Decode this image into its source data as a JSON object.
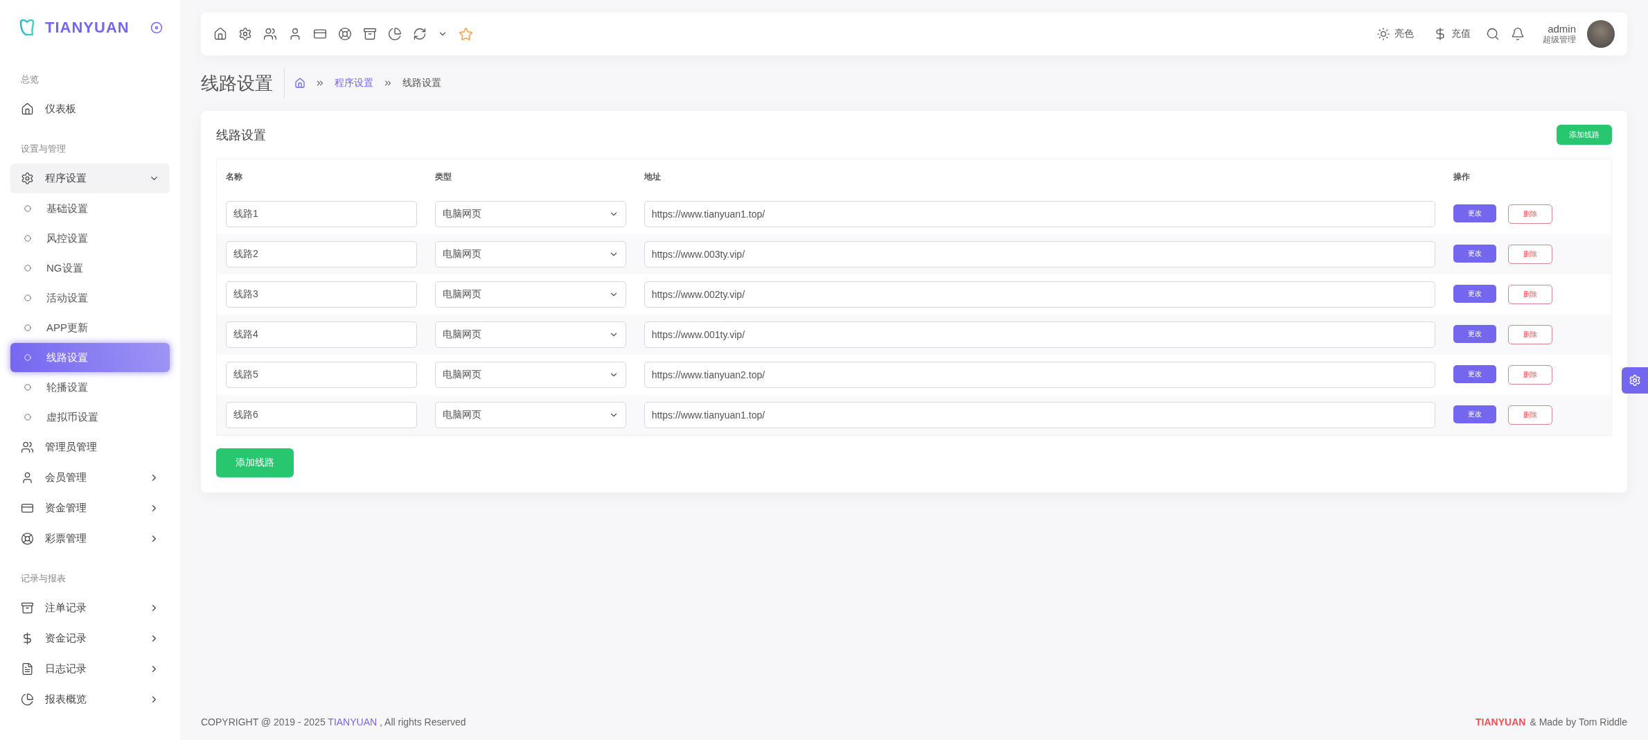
{
  "sidebar": {
    "brand": "TIANYUAN",
    "sections": [
      {
        "title": "总览",
        "items": [
          {
            "kind": "link",
            "label": "仪表板"
          }
        ]
      },
      {
        "title": "设置与管理",
        "items": [
          {
            "kind": "group",
            "label": "程序设置",
            "expanded": true,
            "children": [
              {
                "label": "基础设置",
                "selected": false
              },
              {
                "label": "风控设置",
                "selected": false
              },
              {
                "label": "NG设置",
                "selected": false
              },
              {
                "label": "活动设置",
                "selected": false
              },
              {
                "label": "APP更新",
                "selected": false
              },
              {
                "label": "线路设置",
                "selected": true
              },
              {
                "label": "轮播设置",
                "selected": false
              },
              {
                "label": "虚拟币设置",
                "selected": false
              }
            ]
          },
          {
            "kind": "link",
            "label": "管理员管理"
          },
          {
            "kind": "group",
            "label": "会员管理",
            "expanded": false
          },
          {
            "kind": "group",
            "label": "资金管理",
            "expanded": false
          },
          {
            "kind": "group",
            "label": "彩票管理",
            "expanded": false
          }
        ]
      },
      {
        "title": "记录与报表",
        "items": [
          {
            "kind": "group",
            "label": "注单记录",
            "expanded": false
          },
          {
            "kind": "group",
            "label": "资金记录",
            "expanded": false
          },
          {
            "kind": "group",
            "label": "日志记录",
            "expanded": false
          },
          {
            "kind": "group",
            "label": "报表概览",
            "expanded": false
          }
        ]
      }
    ]
  },
  "topbar": {
    "theme_label": "亮色",
    "recharge_label": "充值",
    "user": {
      "name": "admin",
      "role": "超级管理"
    }
  },
  "page": {
    "title": "线路设置",
    "breadcrumb": [
      "程序设置",
      "线路设置"
    ]
  },
  "card": {
    "title": "线路设置",
    "add_button_top": "添加线路",
    "add_button_bottom": "添加线路",
    "table": {
      "columns": [
        "名称",
        "类型",
        "地址",
        "操作"
      ],
      "rows": [
        {
          "name": "线路1",
          "type": "电脑网页",
          "url": "https://www.tianyuan1.top/",
          "edit": "更改",
          "delete": "删除"
        },
        {
          "name": "线路2",
          "type": "电脑网页",
          "url": "https://www.003ty.vip/",
          "edit": "更改",
          "delete": "删除"
        },
        {
          "name": "线路3",
          "type": "电脑网页",
          "url": "https://www.002ty.vip/",
          "edit": "更改",
          "delete": "删除"
        },
        {
          "name": "线路4",
          "type": "电脑网页",
          "url": "https://www.001ty.vip/",
          "edit": "更改",
          "delete": "删除"
        },
        {
          "name": "线路5",
          "type": "电脑网页",
          "url": "https://www.tianyuan2.top/",
          "edit": "更改",
          "delete": "删除"
        },
        {
          "name": "线路6",
          "type": "电脑网页",
          "url": "https://www.tianyuan1.top/",
          "edit": "更改",
          "delete": "删除"
        }
      ]
    }
  },
  "footer": {
    "copyright": "COPYRIGHT @ 2019 - 2025",
    "copyright_link": "TIANYUAN",
    "copyright_end": ", All rights Reserved",
    "brand": "TIANYUAN",
    "credit": "& Made by Tom Riddle"
  }
}
